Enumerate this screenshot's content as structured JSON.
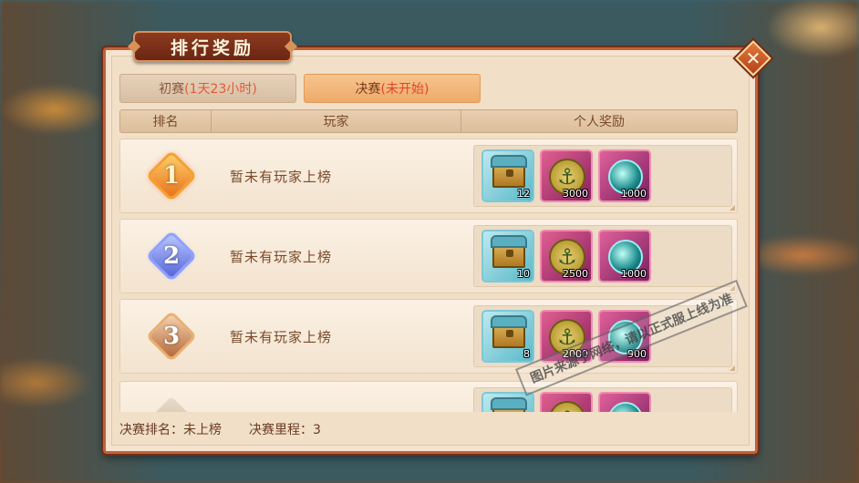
{
  "title": "排行奖励",
  "close_icon": "close-icon",
  "tabs": [
    {
      "label": "初赛",
      "status": "(1天23小时)",
      "active": false
    },
    {
      "label": "决赛",
      "status": "(未开始)",
      "active": true
    }
  ],
  "columns": {
    "rank": "排名",
    "player": "玩家",
    "reward": "个人奖励"
  },
  "rows": [
    {
      "rank": "1",
      "player": "暂未有玩家上榜",
      "rewards": [
        {
          "icon": "treasure-chest-icon",
          "count": "12"
        },
        {
          "icon": "anchor-coin-icon",
          "count": "3000"
        },
        {
          "icon": "teal-orb-icon",
          "count": "1000"
        }
      ]
    },
    {
      "rank": "2",
      "player": "暂未有玩家上榜",
      "rewards": [
        {
          "icon": "treasure-chest-icon",
          "count": "10"
        },
        {
          "icon": "anchor-coin-icon",
          "count": "2500"
        },
        {
          "icon": "teal-orb-icon",
          "count": "1000"
        }
      ]
    },
    {
      "rank": "3",
      "player": "暂未有玩家上榜",
      "rewards": [
        {
          "icon": "treasure-chest-icon",
          "count": "8"
        },
        {
          "icon": "anchor-coin-icon",
          "count": "2000"
        },
        {
          "icon": "teal-orb-icon",
          "count": "900"
        }
      ]
    },
    {
      "rank": "",
      "player": "",
      "rewards": [
        {
          "icon": "treasure-chest-icon",
          "count": ""
        },
        {
          "icon": "anchor-coin-icon",
          "count": ""
        },
        {
          "icon": "teal-orb-icon",
          "count": ""
        }
      ]
    }
  ],
  "footer": {
    "my_rank_label": "决赛排名：",
    "my_rank_value": "未上榜",
    "mileage_label": "决赛里程：",
    "mileage_value": "3"
  },
  "watermark": "图片来源于网络，请以正式服上线为准"
}
